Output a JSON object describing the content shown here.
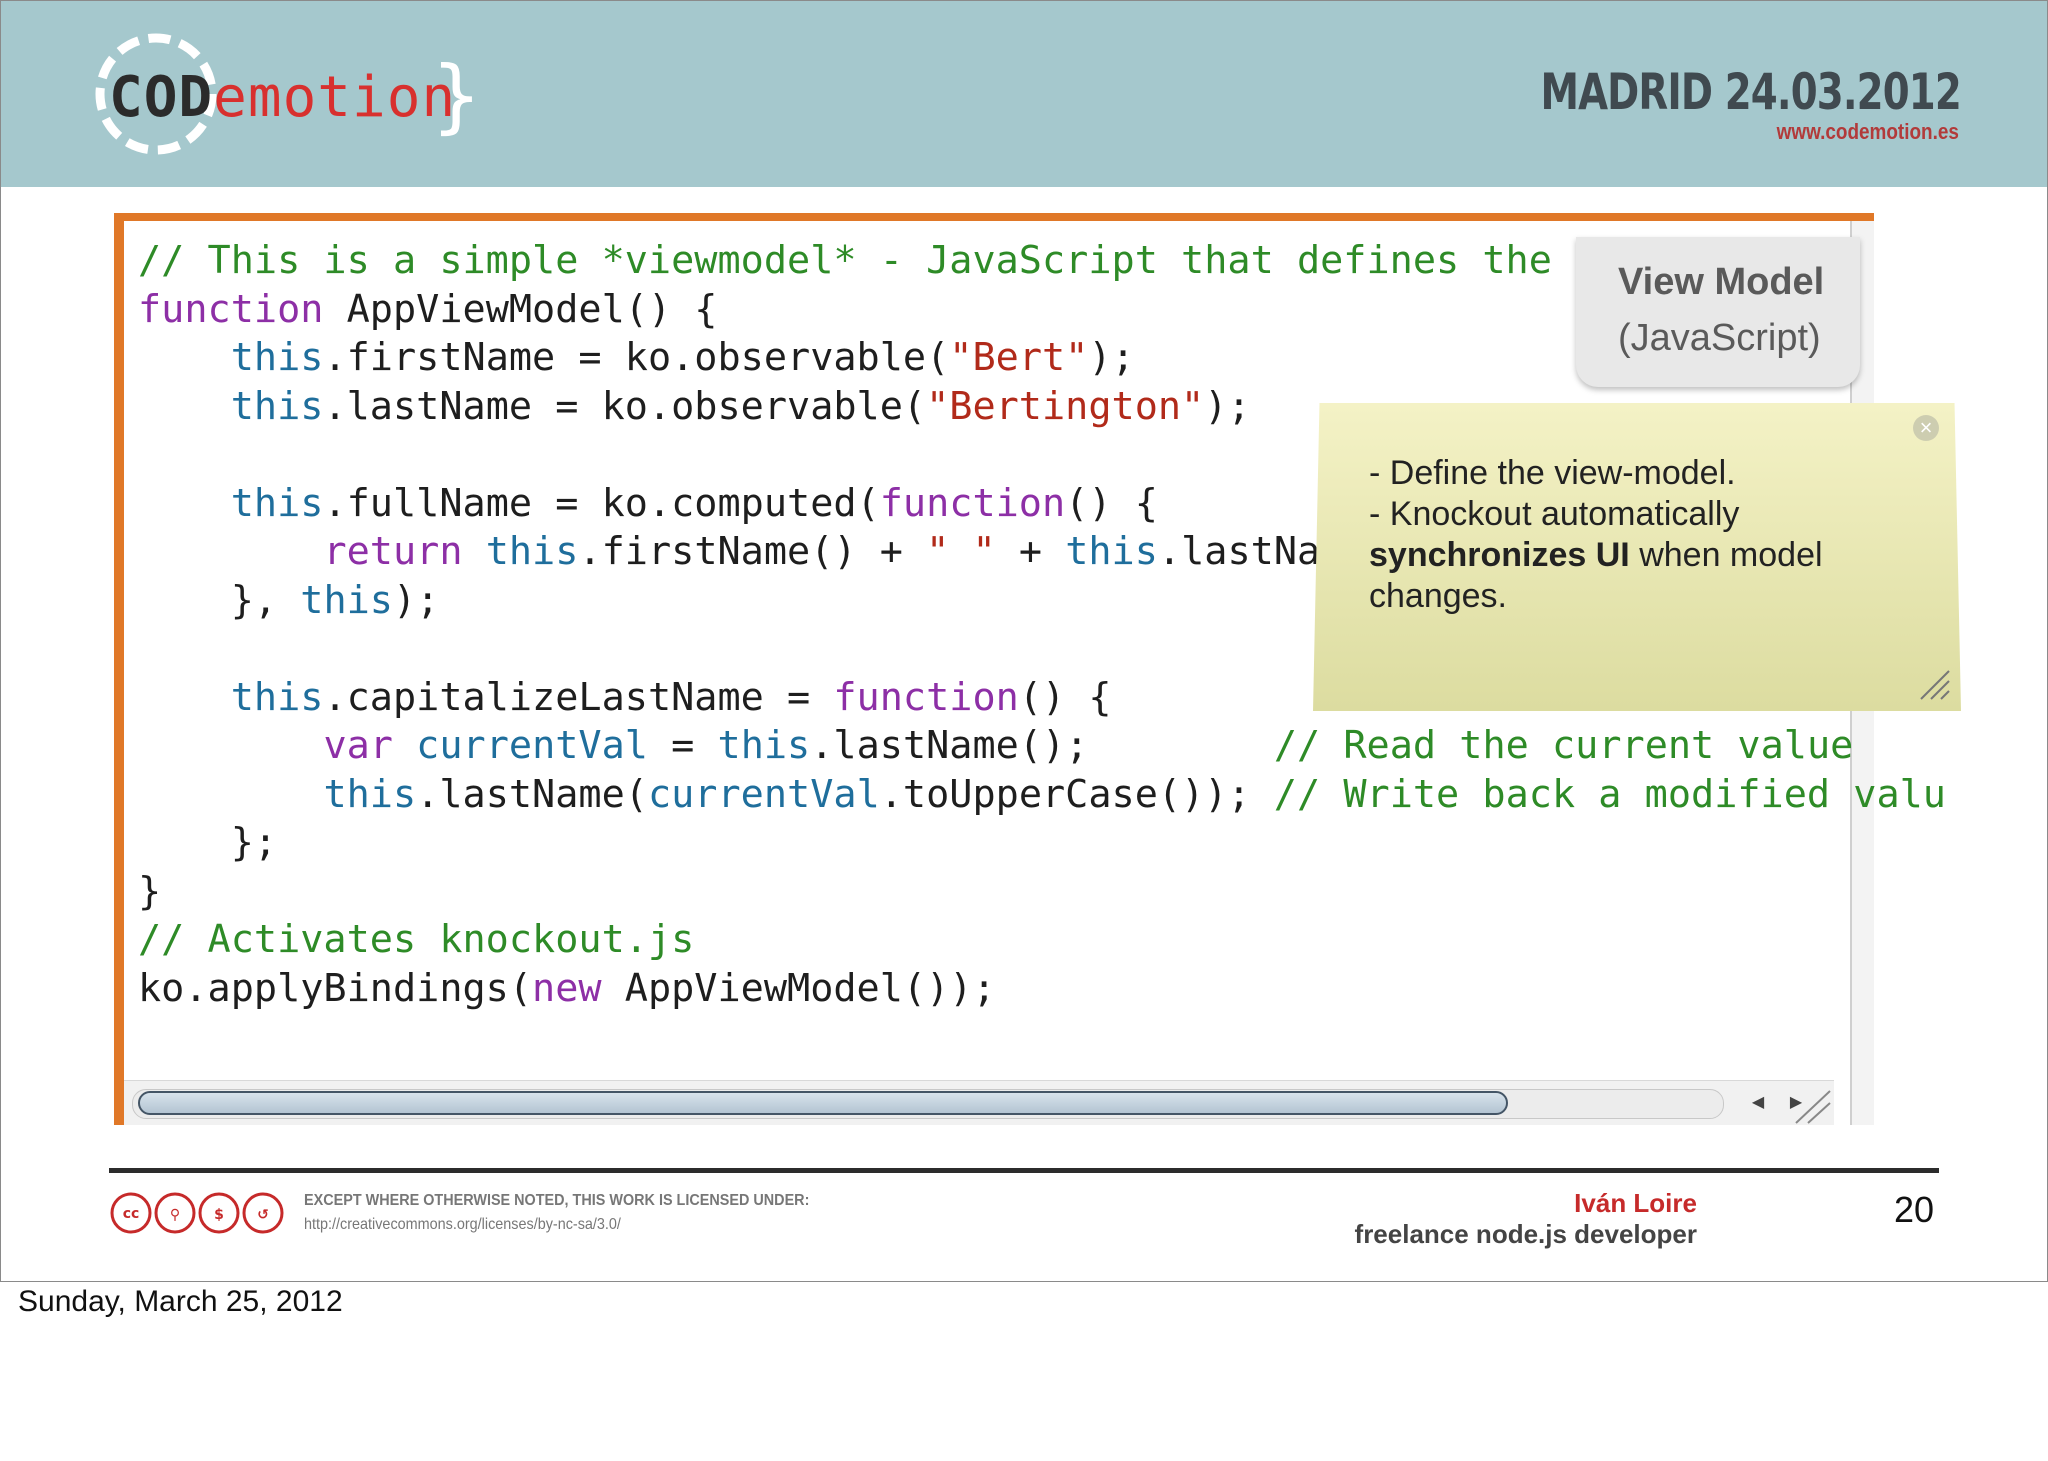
{
  "header": {
    "logo_code": "COD",
    "logo_motion": "emotion",
    "event_date": "MADRID 24.03.2012",
    "event_url": "www.codemotion.es"
  },
  "code_lines": [
    [
      {
        "c": "cm",
        "t": "// This is a simple *viewmodel* - JavaScript that defines the dat"
      }
    ],
    [
      {
        "c": "kw",
        "t": "function"
      },
      {
        "c": "",
        "t": " AppViewModel() {"
      }
    ],
    [
      {
        "c": "",
        "t": "    "
      },
      {
        "c": "th",
        "t": "this"
      },
      {
        "c": "",
        "t": ".firstName = ko.observable("
      },
      {
        "c": "st",
        "t": "\"Bert\""
      },
      {
        "c": "",
        "t": ");"
      }
    ],
    [
      {
        "c": "",
        "t": "    "
      },
      {
        "c": "th",
        "t": "this"
      },
      {
        "c": "",
        "t": ".lastName = ko.observable("
      },
      {
        "c": "st",
        "t": "\"Bertington\""
      },
      {
        "c": "",
        "t": ");"
      }
    ],
    [
      {
        "c": "",
        "t": ""
      }
    ],
    [
      {
        "c": "",
        "t": "    "
      },
      {
        "c": "th",
        "t": "this"
      },
      {
        "c": "",
        "t": ".fullName = ko.computed("
      },
      {
        "c": "kw",
        "t": "function"
      },
      {
        "c": "",
        "t": "() {"
      }
    ],
    [
      {
        "c": "",
        "t": "        "
      },
      {
        "c": "kw",
        "t": "return"
      },
      {
        "c": "",
        "t": " "
      },
      {
        "c": "th",
        "t": "this"
      },
      {
        "c": "",
        "t": ".firstName() + "
      },
      {
        "c": "st",
        "t": "\" \""
      },
      {
        "c": "",
        "t": " + "
      },
      {
        "c": "th",
        "t": "this"
      },
      {
        "c": "",
        "t": ".lastName("
      }
    ],
    [
      {
        "c": "",
        "t": "    }, "
      },
      {
        "c": "th",
        "t": "this"
      },
      {
        "c": "",
        "t": ");"
      }
    ],
    [
      {
        "c": "",
        "t": ""
      }
    ],
    [
      {
        "c": "",
        "t": "    "
      },
      {
        "c": "th",
        "t": "this"
      },
      {
        "c": "",
        "t": ".capitalizeLastName = "
      },
      {
        "c": "kw",
        "t": "function"
      },
      {
        "c": "",
        "t": "() {"
      }
    ],
    [
      {
        "c": "",
        "t": "        "
      },
      {
        "c": "kw",
        "t": "var"
      },
      {
        "c": "",
        "t": " "
      },
      {
        "c": "th",
        "t": "currentVal"
      },
      {
        "c": "",
        "t": " = "
      },
      {
        "c": "th",
        "t": "this"
      },
      {
        "c": "",
        "t": ".lastName();        "
      },
      {
        "c": "cm",
        "t": "// Read the current value"
      }
    ],
    [
      {
        "c": "",
        "t": "        "
      },
      {
        "c": "th",
        "t": "this"
      },
      {
        "c": "",
        "t": ".lastName("
      },
      {
        "c": "th",
        "t": "currentVal"
      },
      {
        "c": "",
        "t": ".toUpperCase()); "
      },
      {
        "c": "cm",
        "t": "// Write back a modified valu"
      }
    ],
    [
      {
        "c": "",
        "t": "    };"
      }
    ],
    [
      {
        "c": "",
        "t": "}"
      }
    ],
    [
      {
        "c": "cm",
        "t": "// Activates knockout.js"
      }
    ],
    [
      {
        "c": "",
        "t": "ko.applyBindings("
      },
      {
        "c": "kw",
        "t": "new"
      },
      {
        "c": "",
        "t": " AppViewModel());"
      }
    ]
  ],
  "view_model_tab": {
    "title": "View Model",
    "subtitle": "(JavaScript)"
  },
  "note": {
    "line1": "- Define the view-model.",
    "line2": "- Knockout automatically",
    "bold": "synchronizes UI",
    "rest": " when model changes."
  },
  "footer": {
    "license_label": "EXCEPT WHERE OTHERWISE NOTED, THIS WORK IS LICENSED UNDER:",
    "license_url": "http://creativecommons.org/licenses/by-nc-sa/3.0/",
    "author_name": "Iván Loire",
    "author_role": "freelance node.js developer",
    "page_number": "20"
  },
  "date_footer": "Sunday, March 25, 2012",
  "colors": {
    "header_bg": "#a5c8cd",
    "accent_red": "#c62a2a",
    "frame_orange": "#e07828",
    "note_bg": "#f4f2c6"
  }
}
